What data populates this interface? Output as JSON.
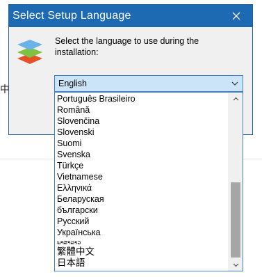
{
  "background": {
    "glyph": "中"
  },
  "dialog": {
    "title": "Select Setup Language",
    "prompt": "Select the language to use during the installation:",
    "logo_icon": "layered-stack-logo",
    "close_icon": "close-icon",
    "selected_language": "English",
    "colors": {
      "titlebar": "#1d69b2",
      "combo_fill": "#cce4f7",
      "accent_border": "#3c7fd1",
      "logo_top": "#6ab3e8",
      "logo_middle": "#7fc241",
      "logo_bottom": "#e94f26"
    }
  },
  "dropdown": {
    "scroll_position_fraction": 0.86,
    "options": [
      "Português Brasileiro",
      "Română",
      "Slovenčina",
      "Slovenski",
      "Suomi",
      "Svenska",
      "Türkçe",
      "Vietnamese",
      "Ελληνικά",
      "Беларуская",
      "български",
      "Русский",
      "Українська",
      "ພາສາລາວ",
      "繁體中文",
      "日本語"
    ]
  }
}
